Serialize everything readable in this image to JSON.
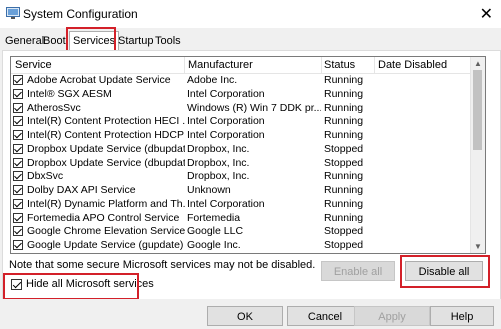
{
  "window": {
    "title": "System Configuration",
    "close_glyph": "✕"
  },
  "tabs": [
    {
      "label": "General"
    },
    {
      "label": "Boot"
    },
    {
      "label": "Services",
      "active": true
    },
    {
      "label": "Startup"
    },
    {
      "label": "Tools"
    }
  ],
  "table": {
    "columns": [
      "Service",
      "Manufacturer",
      "Status",
      "Date Disabled"
    ],
    "rows": [
      {
        "checked": true,
        "service": "Adobe Acrobat Update Service",
        "manufacturer": "Adobe Inc.",
        "status": "Running"
      },
      {
        "checked": true,
        "service": "Intel® SGX AESM",
        "manufacturer": "Intel Corporation",
        "status": "Running"
      },
      {
        "checked": true,
        "service": "AtherosSvc",
        "manufacturer": "Windows (R) Win 7 DDK pr...",
        "status": "Running"
      },
      {
        "checked": true,
        "service": "Intel(R) Content Protection HECI ...",
        "manufacturer": "Intel Corporation",
        "status": "Running"
      },
      {
        "checked": true,
        "service": "Intel(R) Content Protection HDCP ...",
        "manufacturer": "Intel Corporation",
        "status": "Running"
      },
      {
        "checked": true,
        "service": "Dropbox Update Service (dbupdate)",
        "manufacturer": "Dropbox, Inc.",
        "status": "Stopped"
      },
      {
        "checked": true,
        "service": "Dropbox Update Service (dbupdat...",
        "manufacturer": "Dropbox, Inc.",
        "status": "Stopped"
      },
      {
        "checked": true,
        "service": "DbxSvc",
        "manufacturer": "Dropbox, Inc.",
        "status": "Running"
      },
      {
        "checked": true,
        "service": "Dolby DAX API Service",
        "manufacturer": "Unknown",
        "status": "Running"
      },
      {
        "checked": true,
        "service": "Intel(R) Dynamic Platform and Th...",
        "manufacturer": "Intel Corporation",
        "status": "Running"
      },
      {
        "checked": true,
        "service": "Fortemedia APO Control Service",
        "manufacturer": "Fortemedia",
        "status": "Running"
      },
      {
        "checked": true,
        "service": "Google Chrome Elevation Service",
        "manufacturer": "Google LLC",
        "status": "Stopped"
      },
      {
        "checked": true,
        "service": "Google Update Service (gupdate)",
        "manufacturer": "Google Inc.",
        "status": "Stopped"
      }
    ]
  },
  "note": "Note that some secure Microsoft services may not be disabled.",
  "buttons": {
    "enable_all": "Enable all",
    "disable_all": "Disable all",
    "ok": "OK",
    "cancel": "Cancel",
    "apply": "Apply",
    "help": "Help"
  },
  "hide_ms": {
    "label": "Hide all Microsoft services",
    "checked": true
  },
  "colors": {
    "highlight": "#d32029"
  }
}
